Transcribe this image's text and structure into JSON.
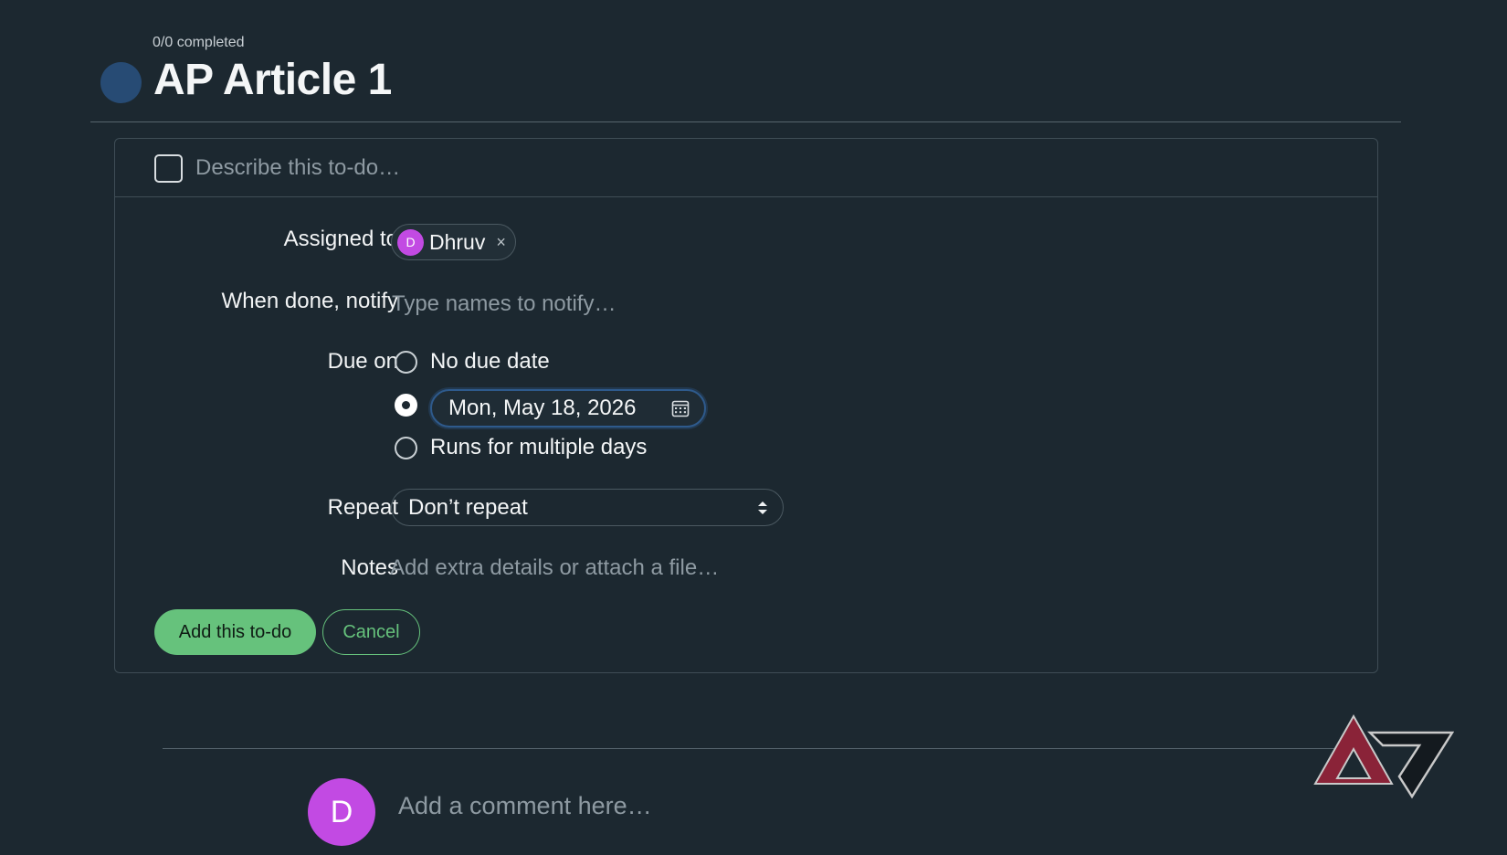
{
  "header": {
    "progress": "0/0 completed",
    "title": "AP Article 1",
    "dot_color": "#274b74"
  },
  "form": {
    "todo_placeholder": "Describe this to-do…",
    "assigned_label": "Assigned to",
    "assignee": {
      "initial": "D",
      "name": "Dhruv",
      "remove_glyph": "×",
      "avatar_color": "#c24ae3"
    },
    "notify_label": "When done, notify",
    "notify_placeholder": "Type names to notify…",
    "due_label": "Due on",
    "due_options": {
      "none": "No due date",
      "date_value": "Mon, May 18, 2026",
      "multiple": "Runs for multiple days"
    },
    "due_selected": "date",
    "repeat_label": "Repeat",
    "repeat_value": "Don’t repeat",
    "notes_label": "Notes",
    "notes_placeholder": "Add extra details or attach a file…",
    "add_button": "Add this to-do",
    "cancel_button": "Cancel",
    "accent_color": "#66c27c"
  },
  "comment": {
    "avatar_initial": "D",
    "placeholder": "Add a comment here…"
  },
  "icons": {
    "calendar": "calendar-icon",
    "repeat_chevrons": "chevron-up-down-icon",
    "watermark": "android-police-logo"
  }
}
